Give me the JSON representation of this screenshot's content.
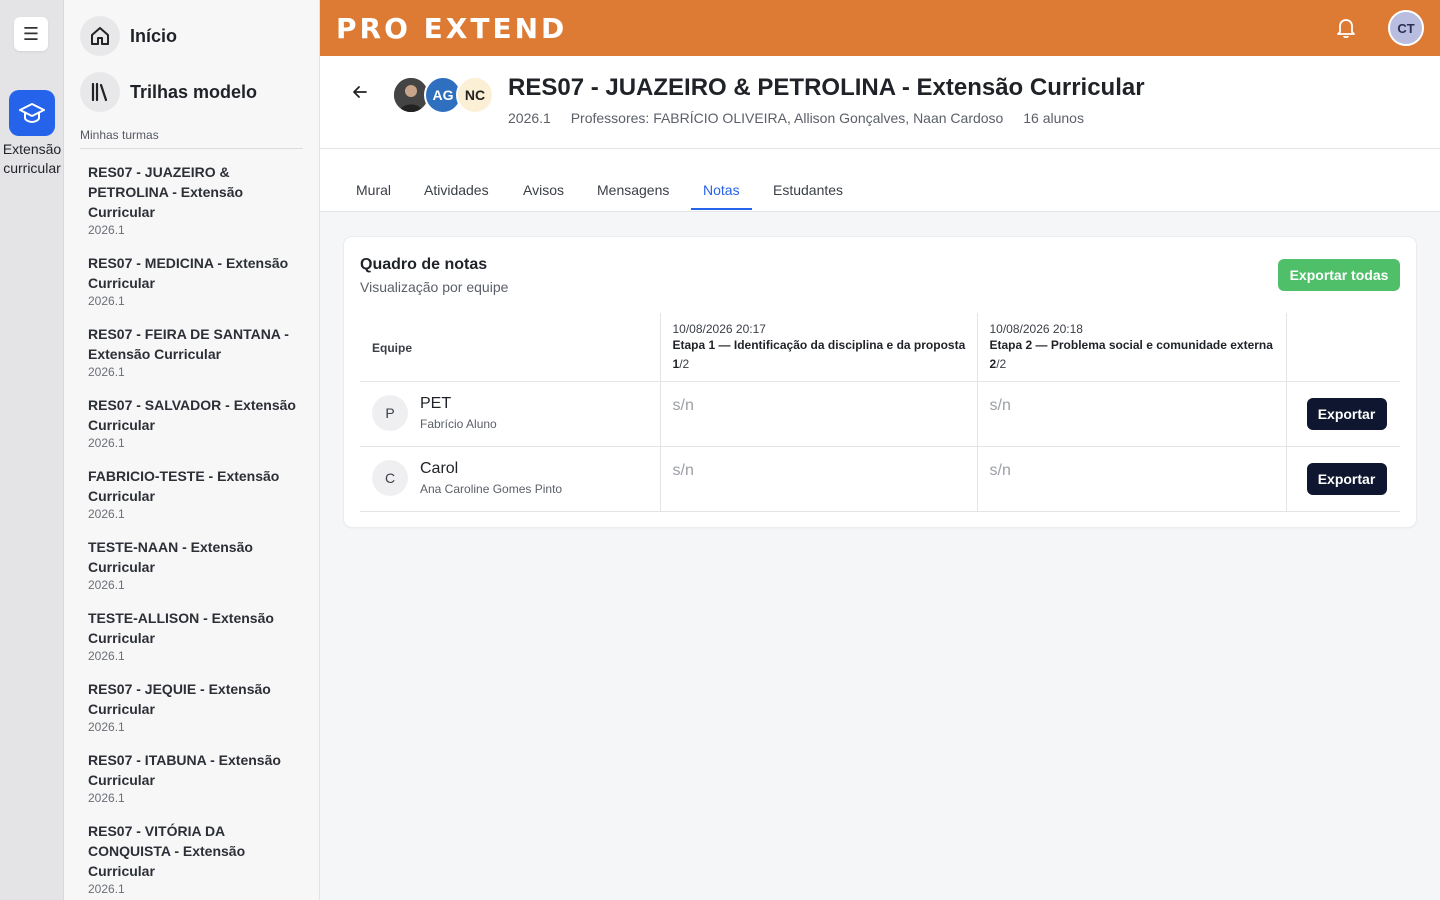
{
  "rail": {
    "app_label": "Extensão curricular"
  },
  "sidebar": {
    "nav": [
      {
        "label": "Início",
        "icon": "home-icon"
      },
      {
        "label": "Trilhas modelo",
        "icon": "library-icon"
      }
    ],
    "section_title": "Minhas turmas",
    "classes": [
      {
        "name": "RES07 - JUAZEIRO & PETROLINA - Extensão Curricular",
        "term": "2026.1"
      },
      {
        "name": "RES07 - MEDICINA - Extensão Curricular",
        "term": "2026.1"
      },
      {
        "name": "RES07 - FEIRA DE SANTANA - Extensão Curricular",
        "term": "2026.1"
      },
      {
        "name": "RES07 - SALVADOR - Extensão Curricular",
        "term": "2026.1"
      },
      {
        "name": "FABRICIO-TESTE - Extensão Curricular",
        "term": "2026.1"
      },
      {
        "name": "TESTE-NAAN - Extensão Curricular",
        "term": "2026.1"
      },
      {
        "name": "TESTE-ALLISON - Extensão Curricular",
        "term": "2026.1"
      },
      {
        "name": "RES07 - JEQUIE - Extensão Curricular",
        "term": "2026.1"
      },
      {
        "name": "RES07 - ITABUNA - Extensão Curricular",
        "term": "2026.1"
      },
      {
        "name": "RES07 - VITÓRIA DA CONQUISTA - Extensão Curricular",
        "term": "2026.1"
      }
    ]
  },
  "topbar": {
    "logo": "PRO EXTEND",
    "user_initials": "CT",
    "color": "#dd7b35"
  },
  "header": {
    "avatars": [
      "AG",
      "NC"
    ],
    "title": "RES07 - JUAZEIRO & PETROLINA - Extensão Curricular",
    "term": "2026.1",
    "professors": "Professores: FABRÍCIO OLIVEIRA, Allison Gonçalves, Naan Cardoso",
    "students": "16 alunos"
  },
  "tabs": [
    {
      "label": "Mural"
    },
    {
      "label": "Atividades"
    },
    {
      "label": "Avisos"
    },
    {
      "label": "Mensagens"
    },
    {
      "label": "Notas",
      "active": true
    },
    {
      "label": "Estudantes"
    }
  ],
  "gradebook": {
    "title": "Quadro de notas",
    "subtitle": "Visualização por equipe",
    "export_all_label": "Exportar todas",
    "team_header": "Equipe",
    "stages": [
      {
        "date": "10/08/2026 20:17",
        "name": "Etapa 1 — Identificação da disciplina e da proposta",
        "current": "1",
        "total": "/2"
      },
      {
        "date": "10/08/2026 20:18",
        "name": "Etapa 2 — Problema social e comunidade externa",
        "current": "2",
        "total": "/2"
      }
    ],
    "rows": [
      {
        "initial": "P",
        "team": "PET",
        "member": "Fabrício Aluno",
        "grades": [
          "s/n",
          "s/n"
        ],
        "action": "Exportar"
      },
      {
        "initial": "C",
        "team": "Carol",
        "member": "Ana Caroline Gomes Pinto",
        "grades": [
          "s/n",
          "s/n"
        ],
        "action": "Exportar"
      }
    ]
  }
}
